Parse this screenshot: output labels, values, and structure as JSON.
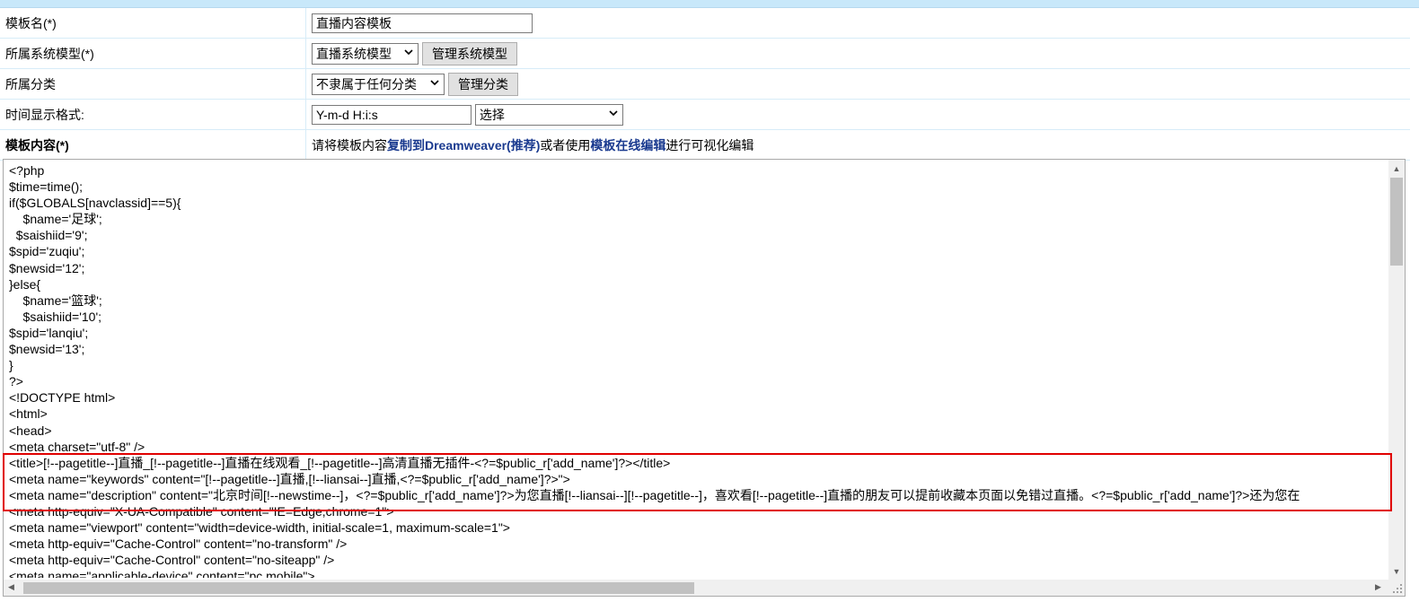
{
  "form": {
    "template_name_label": "模板名(*)",
    "template_name_value": "直播内容模板",
    "system_model_label": "所属系统模型(*)",
    "system_model_selected": "直播系统模型",
    "manage_model_button": "管理系统模型",
    "category_label": "所属分类",
    "category_selected": "不隶属于任何分类",
    "manage_category_button": "管理分类",
    "time_format_label": "时间显示格式:",
    "time_format_value": "Y-m-d H:i:s",
    "time_format_select": "选择",
    "content_label": "模板内容(*)",
    "content_hint_pre": "请将模板内容",
    "content_hint_link1": "复制到Dreamweaver(推荐)",
    "content_hint_mid": "或者使用",
    "content_hint_link2": "模板在线编辑",
    "content_hint_post": "进行可视化编辑"
  },
  "editor": {
    "code": "<?php\n$time=time();\nif($GLOBALS[navclassid]==5){\n    $name='足球';\n  $saishiid='9';\n$spid='zuqiu';\n$newsid='12';\n}else{\n    $name='篮球';\n    $saishiid='10';\n$spid='lanqiu';\n$newsid='13';\n}\n?>\n<!DOCTYPE html>\n<html>\n<head>\n<meta charset=\"utf-8\" />\n<title>[!--pagetitle--]直播_[!--pagetitle--]直播在线观看_[!--pagetitle--]高清直播无插件-<?=$public_r['add_name']?></title>\n<meta name=\"keywords\" content=\"[!--pagetitle--]直播,[!--liansai--]直播,<?=$public_r['add_name']?>\">\n<meta name=\"description\" content=\"北京时间[!--newstime--]，<?=$public_r['add_name']?>为您直播[!--liansai--][!--pagetitle--]，喜欢看[!--pagetitle--]直播的朋友可以提前收藏本页面以免错过直播。<?=$public_r['add_name']?>还为您在\n<meta http-equiv=\"X-UA-Compatible\" content=\"IE=Edge,chrome=1\">\n<meta name=\"viewport\" content=\"width=device-width, initial-scale=1, maximum-scale=1\">\n<meta http-equiv=\"Cache-Control\" content=\"no-transform\" />\n<meta http-equiv=\"Cache-Control\" content=\"no-siteapp\" />\n<meta name=\"applicable-device\" content=\"pc,mobile\">"
  },
  "colors": {
    "topbar": "#c8e8fa",
    "link": "#1a3a8f",
    "highlight_border": "#e00000"
  }
}
